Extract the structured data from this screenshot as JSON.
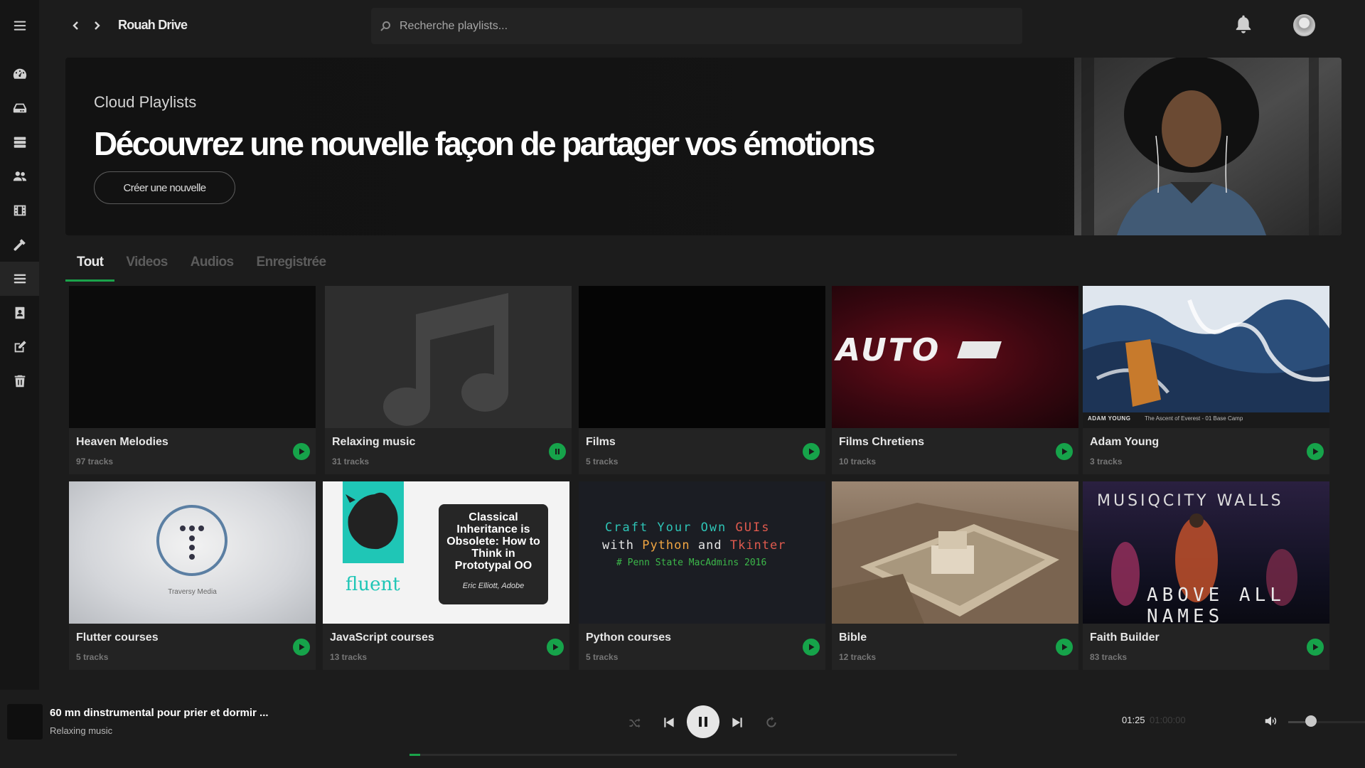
{
  "header": {
    "brand": "Rouah Drive",
    "search_placeholder": "Recherche playlists..."
  },
  "hero": {
    "eyebrow": "Cloud Playlists",
    "title": "Découvrez une nouvelle façon de partager vos émotions",
    "button_label": "Créer une nouvelle"
  },
  "sidebar": {
    "items": [
      {
        "icon": "menu-icon"
      },
      {
        "icon": "dashboard-icon"
      },
      {
        "icon": "drive-icon"
      },
      {
        "icon": "server-icon"
      },
      {
        "icon": "users-icon"
      },
      {
        "icon": "film-icon"
      },
      {
        "icon": "tools-icon"
      },
      {
        "icon": "list-icon",
        "active": true
      },
      {
        "icon": "contact-icon"
      },
      {
        "icon": "edit-icon"
      },
      {
        "icon": "trash-icon"
      }
    ]
  },
  "tabs": [
    {
      "label": "Tout",
      "active": true
    },
    {
      "label": "Videos"
    },
    {
      "label": "Audios"
    },
    {
      "label": "Enregistrée"
    }
  ],
  "cards": [
    {
      "title": "Heaven Melodies",
      "count": "97 tracks",
      "state": "play"
    },
    {
      "title": "Relaxing music",
      "count": "31 tracks",
      "state": "pause"
    },
    {
      "title": "Films",
      "count": "5 tracks",
      "state": "play"
    },
    {
      "title": "Films Chretiens",
      "count": "10 tracks",
      "state": "play",
      "thumb_text": "AUTO"
    },
    {
      "title": "Adam Young",
      "count": "3 tracks",
      "state": "play",
      "thumb_caption_artist": "ADAM YOUNG",
      "thumb_caption_track": "The Ascent of Everest - 01 Base Camp"
    },
    {
      "title": "Flutter courses",
      "count": "5 tracks",
      "state": "play",
      "thumb_text": "Traversy Media"
    },
    {
      "title": "JavaScript courses",
      "count": "13 tracks",
      "state": "play",
      "thumb_brand": "fluent",
      "thumb_text": "Classical Inheritance is Obsolete: How to Think in Prototypal OO",
      "thumb_author": "Eric Elliott, Adobe"
    },
    {
      "title": "Python courses",
      "count": "5 tracks",
      "state": "play",
      "thumb_line1a": "Craft Your Own",
      "thumb_line1b": "GUIs",
      "thumb_line2a": "with",
      "thumb_line2b": "Python",
      "thumb_line2c": "and",
      "thumb_line2d": "Tkinter",
      "thumb_line3": "# Penn State MacAdmins 2016"
    },
    {
      "title": "Bible",
      "count": "12 tracks",
      "state": "play"
    },
    {
      "title": "Faith Builder",
      "count": "83 tracks",
      "state": "play",
      "thumb_title": "MUSIQCITY WALLS",
      "thumb_sub": "ABOVE ALL NAMES"
    }
  ],
  "player": {
    "title": "60 mn dinstrumental pour prier et dormir ...",
    "subtitle": "Relaxing music",
    "time_current": "01:25",
    "time_total": "01:00:00",
    "progress": 0.02,
    "volume": 0.3
  },
  "colors": {
    "accent": "#1aa34a",
    "play_button": "#16a34a",
    "background": "#1c1c1c",
    "sidebar": "#151515"
  }
}
